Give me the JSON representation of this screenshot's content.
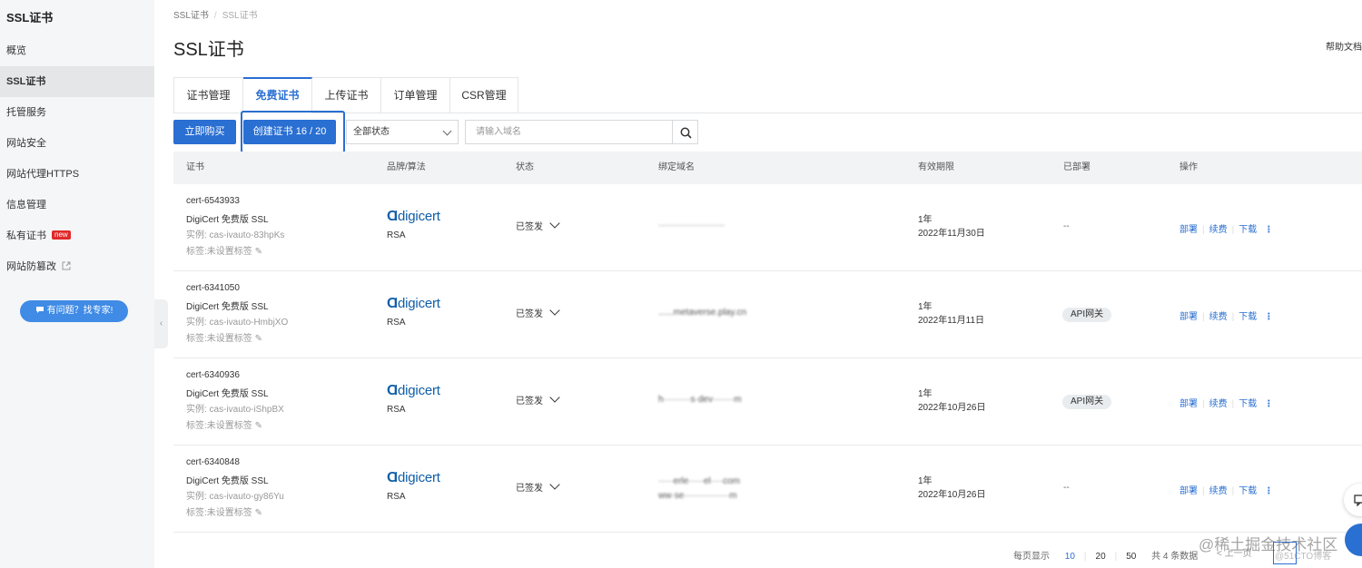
{
  "sidebar": {
    "title": "SSL证书",
    "items": [
      {
        "label": "概览",
        "active": false
      },
      {
        "label": "SSL证书",
        "active": true
      },
      {
        "label": "托管服务",
        "active": false
      },
      {
        "label": "网站安全",
        "active": false
      },
      {
        "label": "网站代理HTTPS",
        "active": false
      },
      {
        "label": "信息管理",
        "active": false
      },
      {
        "label": "私有证书",
        "active": false,
        "badge": "new"
      },
      {
        "label": "网站防篡改",
        "active": false,
        "external": true
      }
    ],
    "help_button": "有问题？找专家!"
  },
  "breadcrumb": [
    "SSL证书",
    "SSL证书"
  ],
  "page_title": "SSL证书",
  "help_doc": "帮助文档",
  "tabs": [
    {
      "label": "证书管理",
      "active": false
    },
    {
      "label": "免费证书",
      "active": true
    },
    {
      "label": "上传证书",
      "active": false
    },
    {
      "label": "订单管理",
      "active": false
    },
    {
      "label": "CSR管理",
      "active": false
    }
  ],
  "toolbar": {
    "buy_label": "立即购买",
    "create_label": "创建证书 16 / 20",
    "status_select": "全部状态",
    "search_placeholder": "请输入域名"
  },
  "table": {
    "headers": [
      "证书",
      "品牌/算法",
      "状态",
      "绑定域名",
      "有效期限",
      "已部署",
      "操作"
    ],
    "rows": [
      {
        "id": "cert-6543933",
        "name": "DigiCert 免费版 SSL",
        "instance": "实例: cas-ivauto-83hpKs",
        "tag": "标签:未设置标签",
        "brand": "digicert",
        "algo": "RSA",
        "status": "已签发",
        "domains": [
          "······················"
        ],
        "validity_term": "1年",
        "validity_date": "2022年11月30日",
        "deployed": "--",
        "deployed_badge": false
      },
      {
        "id": "cert-6341050",
        "name": "DigiCert 免费版 SSL",
        "instance": "实例: cas-ivauto-HmbjXO",
        "tag": "标签:未设置标签",
        "brand": "digicert",
        "algo": "RSA",
        "status": "已签发",
        "domains": [
          "......metaverse.play.cn"
        ],
        "validity_term": "1年",
        "validity_date": "2022年11月11日",
        "deployed": "API网关",
        "deployed_badge": true
      },
      {
        "id": "cert-6340936",
        "name": "DigiCert 免费版 SSL",
        "instance": "实例: cas-ivauto-iShpBX",
        "tag": "标签:未设置标签",
        "brand": "digicert",
        "algo": "RSA",
        "status": "已签发",
        "domains": [
          "h·········s·dev·······m"
        ],
        "validity_term": "1年",
        "validity_date": "2022年10月26日",
        "deployed": "API网关",
        "deployed_badge": true
      },
      {
        "id": "cert-6340848",
        "name": "DigiCert 免费版 SSL",
        "instance": "实例: cas-ivauto-gy86Yu",
        "tag": "标签:未设置标签",
        "brand": "digicert",
        "algo": "RSA",
        "status": "已签发",
        "domains": [
          "·····erle·····el····com",
          "ww·se···············m"
        ],
        "validity_term": "1年",
        "validity_date": "2022年10月26日",
        "deployed": "--",
        "deployed_badge": false
      }
    ],
    "actions": [
      "部署",
      "续费",
      "下载"
    ]
  },
  "pager": {
    "per_page_label": "每页显示",
    "sizes": [
      "10",
      "20",
      "50"
    ],
    "current_size": "10",
    "total": "共 4 条数据",
    "prev": "< 上一页"
  },
  "watermark": "@稀土掘金技术社区",
  "watermark2": "@51CTO博客",
  "colors": {
    "accent": "#2a6fd2",
    "sidebar_bg": "#f5f6f7",
    "header_bg": "#f1f3f5",
    "badge_new": "#e0292a"
  }
}
